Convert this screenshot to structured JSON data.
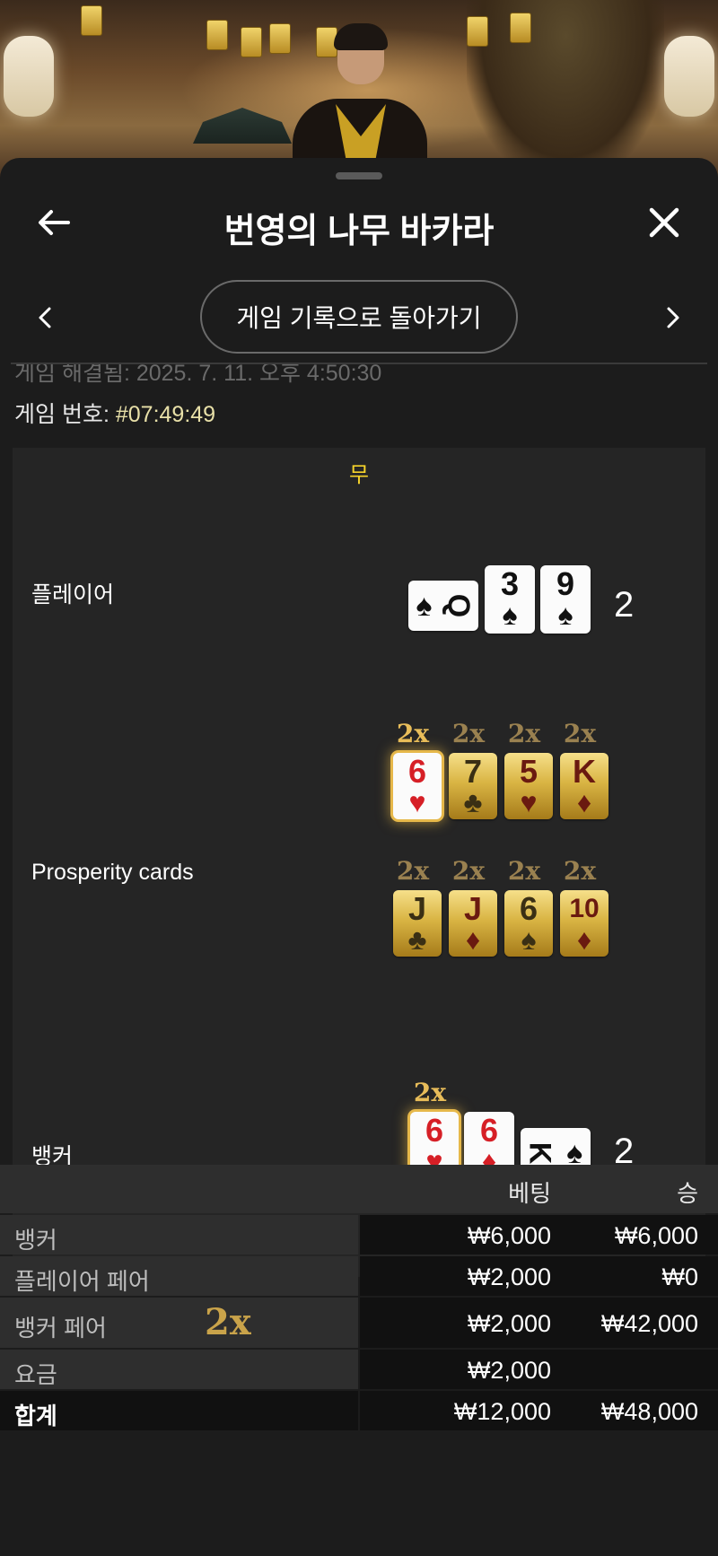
{
  "header": {
    "title": "번영의 나무 바카라"
  },
  "nav": {
    "back_to_history_label": "게임 기록으로 돌아가기"
  },
  "meta": {
    "ended_text": "게임 해결됨: 2025. 7. 11. 오후 4:50:30",
    "game_number_label": "게임 번호:",
    "game_number_value": "#07:49:49"
  },
  "result": {
    "outcome_label": "무",
    "player": {
      "label": "플레이어",
      "total": "2",
      "cards": [
        {
          "rank": "Q",
          "suit": "♠",
          "color": "black",
          "orientation": "sideways"
        },
        {
          "rank": "3",
          "suit": "♠",
          "color": "black"
        },
        {
          "rank": "9",
          "suit": "♠",
          "color": "black"
        }
      ]
    },
    "prosperity": {
      "label": "Prosperity cards",
      "cards": [
        {
          "rank": "6",
          "suit": "♥",
          "color": "red",
          "multiplier": "2x",
          "active": true
        },
        {
          "rank": "7",
          "suit": "♣",
          "color": "black",
          "multiplier": "2x",
          "active": false
        },
        {
          "rank": "5",
          "suit": "♥",
          "color": "red",
          "multiplier": "2x",
          "active": false
        },
        {
          "rank": "K",
          "suit": "♦",
          "color": "red",
          "multiplier": "2x",
          "active": false
        },
        {
          "rank": "J",
          "suit": "♣",
          "color": "black",
          "multiplier": "2x",
          "active": false
        },
        {
          "rank": "J",
          "suit": "♦",
          "color": "red",
          "multiplier": "2x",
          "active": false
        },
        {
          "rank": "6",
          "suit": "♠",
          "color": "black",
          "multiplier": "2x",
          "active": false
        },
        {
          "rank": "10",
          "suit": "♦",
          "color": "red",
          "multiplier": "2x",
          "active": false
        }
      ]
    },
    "banker": {
      "label": "뱅커",
      "total": "2",
      "multiplier": "2x",
      "cards": [
        {
          "rank": "6",
          "suit": "♥",
          "color": "red",
          "highlighted": true
        },
        {
          "rank": "6",
          "suit": "♦",
          "color": "red"
        },
        {
          "rank": "K",
          "suit": "♠",
          "color": "black",
          "orientation": "sideways"
        }
      ]
    }
  },
  "bets": {
    "columns": {
      "bet": "베팅",
      "win": "승"
    },
    "rows": [
      {
        "name": "뱅커",
        "bet": "₩6,000",
        "win": "₩6,000"
      },
      {
        "name": "플레이어 페어",
        "bet": "₩2,000",
        "win": "₩0"
      },
      {
        "name": "뱅커 페어",
        "bet": "₩2,000",
        "win": "₩42,000",
        "multiplier": "2x"
      },
      {
        "name": "요금",
        "bet": "₩2,000",
        "win": ""
      }
    ],
    "total": {
      "name": "합계",
      "bet": "₩12,000",
      "win": "₩48,000"
    }
  },
  "colors": {
    "accent_yellow": "#f5d22b",
    "gold_multiplier": "#e8bd5a",
    "sheet_bg": "#1c1c1c"
  }
}
